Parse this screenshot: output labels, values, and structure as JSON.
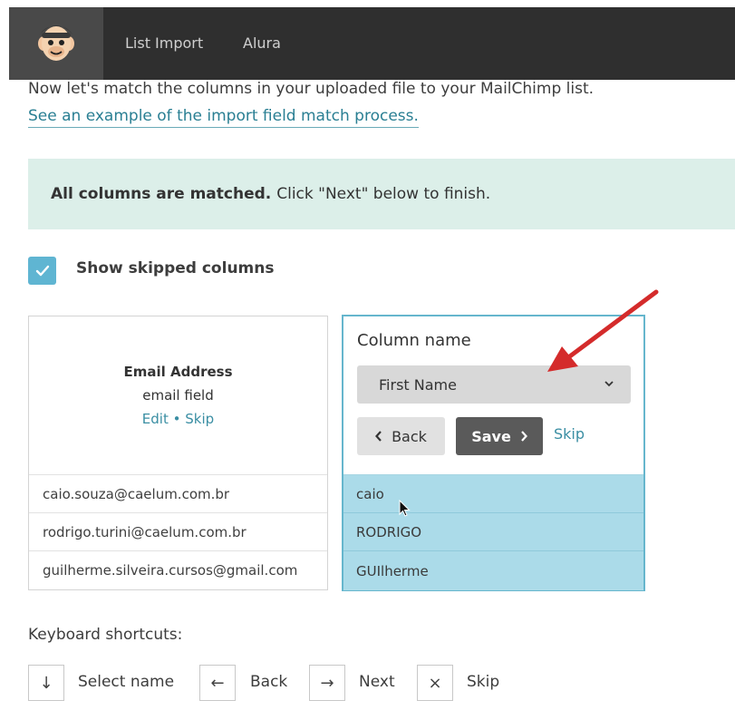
{
  "nav": {
    "items": [
      {
        "label": "List Import"
      },
      {
        "label": "Alura"
      }
    ]
  },
  "intro": {
    "text": "Now let's match the columns in your uploaded file to your MailChimp list.",
    "link": "See an example of the import field match process."
  },
  "banner": {
    "bold": "All columns are matched.",
    "rest": "Click \"Next\" below to finish."
  },
  "show_skipped": {
    "label": "Show skipped columns",
    "checked": true
  },
  "source_column": {
    "title": "Email Address",
    "subtitle": "email field",
    "edit": "Edit",
    "sep": "•",
    "skip": "Skip",
    "rows": [
      "caio.souza@caelum.com.br",
      "rodrigo.turini@caelum.com.br",
      "guilherme.silveira.cursos@gmail.com"
    ]
  },
  "target_column": {
    "label": "Column name",
    "selected": "First Name",
    "back": "Back",
    "save": "Save",
    "skip": "Skip",
    "rows": [
      "caio",
      "RODRIGO",
      "GUIlherme"
    ]
  },
  "shortcuts": {
    "title": "Keyboard shortcuts:",
    "items": [
      {
        "key": "↓",
        "label": "Select name"
      },
      {
        "key": "←",
        "label": "Back"
      },
      {
        "key": "→",
        "label": "Next"
      },
      {
        "key": "×",
        "label": "Skip"
      }
    ]
  },
  "colors": {
    "accent": "#5fb5d2",
    "link": "#3a8ea3",
    "banner": "#dcefe9",
    "highlight": "#abdbe9",
    "annotation_arrow": "#d42b2b"
  },
  "icons": {
    "logo": "mailchimp-freddie-icon",
    "checkbox": "checkmark-icon",
    "select": "chevron-down-icon",
    "back": "chevron-left-icon",
    "save": "chevron-right-icon"
  }
}
